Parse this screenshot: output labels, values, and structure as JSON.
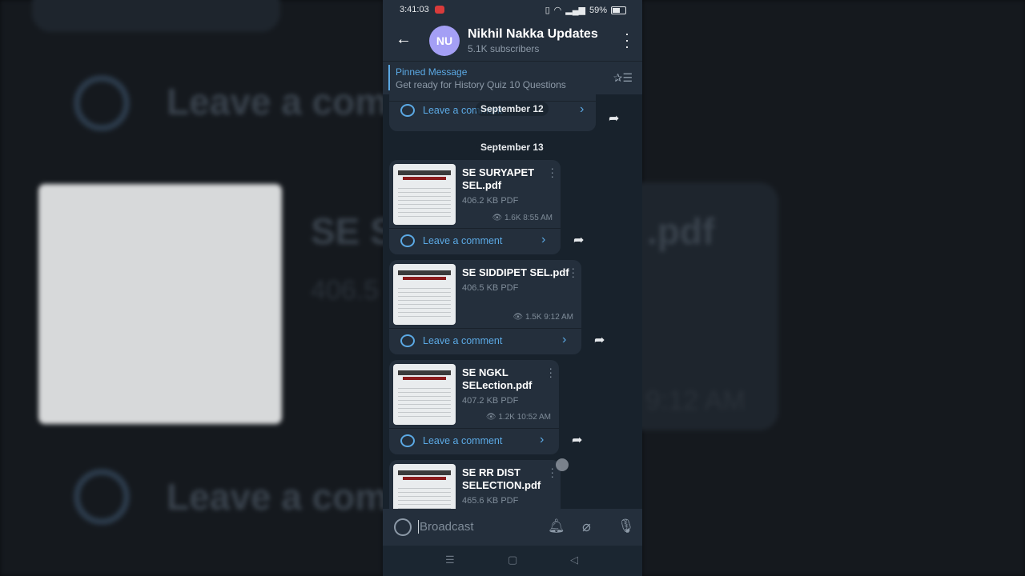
{
  "status_bar": {
    "time": "3:41:03",
    "battery": "59%"
  },
  "channel": {
    "avatar_initials": "NU",
    "name": "Nikhil Nakka Updates",
    "subscribers": "5.1K subscribers"
  },
  "pinned": {
    "title": "Pinned Message",
    "text": "Get ready for History Quiz 10 Questions"
  },
  "dates": {
    "prev": "September 12",
    "current": "September 13"
  },
  "comment_label": "Leave a comment",
  "posts": [
    {
      "name_line1": "SE SURYAPET",
      "name_line2": "SEL.pdf",
      "size": "406.2 KB PDF",
      "views": "1.6K",
      "time": "8:55 AM"
    },
    {
      "name_line1": "SE SIDDIPET SEL.pdf",
      "name_line2": "",
      "size": "406.5 KB PDF",
      "views": "1.5K",
      "time": "9:12 AM"
    },
    {
      "name_line1": "SE NGKL",
      "name_line2": "SELection.pdf",
      "size": "407.2 KB PDF",
      "views": "1.2K",
      "time": "10:52 AM"
    },
    {
      "name_line1": "SE RR DIST",
      "name_line2": "SELECTION.pdf",
      "size": "465.6 KB PDF",
      "views": "",
      "time": ""
    }
  ],
  "input": {
    "placeholder": "Broadcast"
  },
  "backdrop": {
    "big_text": "Leave a comm",
    "big_title": "SE S",
    "big_title_end": ".pdf",
    "big_size": "406.5",
    "big_time": "9:12 AM"
  },
  "colors": {
    "accent": "#5ba9e4",
    "header": "#242f3c",
    "bubble": "#242f3c",
    "avatar": "#a49ff5"
  },
  "icons": [
    "back-arrow-icon",
    "kebab-menu-icon",
    "pin-list-icon",
    "comment-icon",
    "chevron-right-icon",
    "share-icon",
    "eye-icon",
    "emoji-icon",
    "bell-icon",
    "paperclip-icon",
    "microphone-icon"
  ]
}
